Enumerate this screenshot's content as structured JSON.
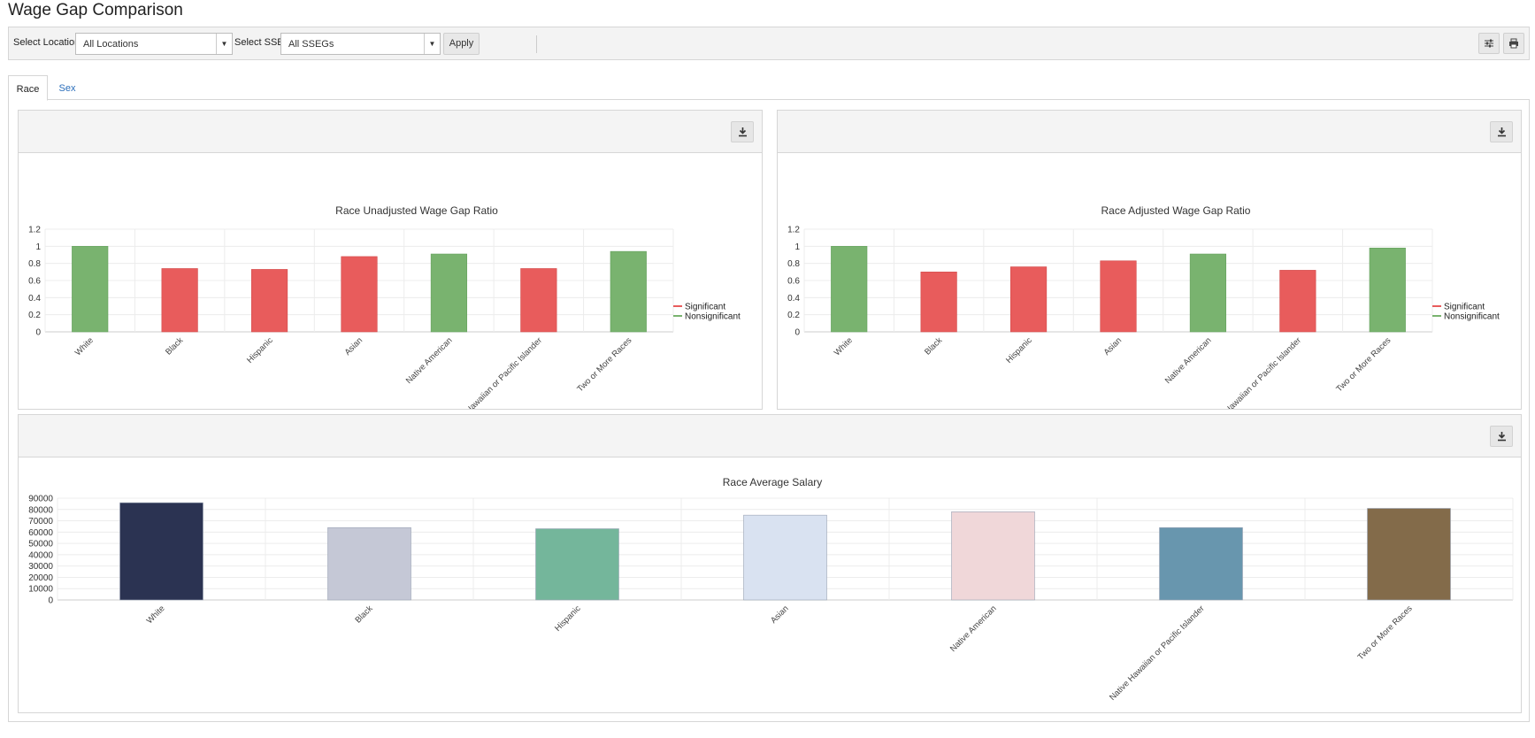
{
  "page": {
    "title": "Wage Gap Comparison"
  },
  "toolbar": {
    "location_label": "Select Location",
    "location_value": "All Locations",
    "sseg_label": "Select SSEG",
    "sseg_value": "All SSEGs",
    "apply_label": "Apply"
  },
  "tabs": [
    {
      "label": "Race",
      "active": true
    },
    {
      "label": "Sex",
      "active": false
    }
  ],
  "chart_data": [
    {
      "type": "bar",
      "title": "Race Unadjusted Wage Gap Ratio",
      "categories": [
        "White",
        "Black",
        "Hispanic",
        "Asian",
        "Native American",
        "Native Hawaiian or Pacific Islander",
        "Two or More Races"
      ],
      "values": [
        1.0,
        0.74,
        0.73,
        0.88,
        0.91,
        0.74,
        0.94
      ],
      "significance": [
        "Nonsignificant",
        "Significant",
        "Significant",
        "Significant",
        "Nonsignificant",
        "Significant",
        "Nonsignificant"
      ],
      "ylim": [
        0,
        1.2
      ],
      "yticks": [
        "0",
        "0.2",
        "0.4",
        "0.6",
        "0.8",
        "1",
        "1.2"
      ],
      "legend": [
        {
          "name": "Significant",
          "color": "#e85c5c"
        },
        {
          "name": "Nonsignificant",
          "color": "#79b36f"
        }
      ],
      "legend_position": "right",
      "grid": true
    },
    {
      "type": "bar",
      "title": "Race Adjusted Wage Gap Ratio",
      "categories": [
        "White",
        "Black",
        "Hispanic",
        "Asian",
        "Native American",
        "Native Hawaiian or Pacific Islander",
        "Two or More Races"
      ],
      "values": [
        1.0,
        0.7,
        0.76,
        0.83,
        0.91,
        0.72,
        0.98
      ],
      "significance": [
        "Nonsignificant",
        "Significant",
        "Significant",
        "Significant",
        "Nonsignificant",
        "Significant",
        "Nonsignificant"
      ],
      "ylim": [
        0,
        1.2
      ],
      "yticks": [
        "0",
        "0.2",
        "0.4",
        "0.6",
        "0.8",
        "1",
        "1.2"
      ],
      "legend": [
        {
          "name": "Significant",
          "color": "#e85c5c"
        },
        {
          "name": "Nonsignificant",
          "color": "#79b36f"
        }
      ],
      "legend_position": "right",
      "grid": true
    },
    {
      "type": "bar",
      "title": "Race Average Salary",
      "categories": [
        "White",
        "Black",
        "Hispanic",
        "Asian",
        "Native American",
        "Native Hawaiian or Pacific Islander",
        "Two or More Races"
      ],
      "values": [
        86000,
        64000,
        63000,
        75000,
        78000,
        64000,
        81000
      ],
      "colors": [
        "#2b3352",
        "#c5c8d6",
        "#74b69b",
        "#d9e2f1",
        "#f0d7d9",
        "#6896ae",
        "#836b4a"
      ],
      "ylim": [
        0,
        90000
      ],
      "yticks": [
        "0",
        "10000",
        "20000",
        "30000",
        "40000",
        "50000",
        "60000",
        "70000",
        "80000",
        "90000"
      ],
      "grid": true
    }
  ]
}
